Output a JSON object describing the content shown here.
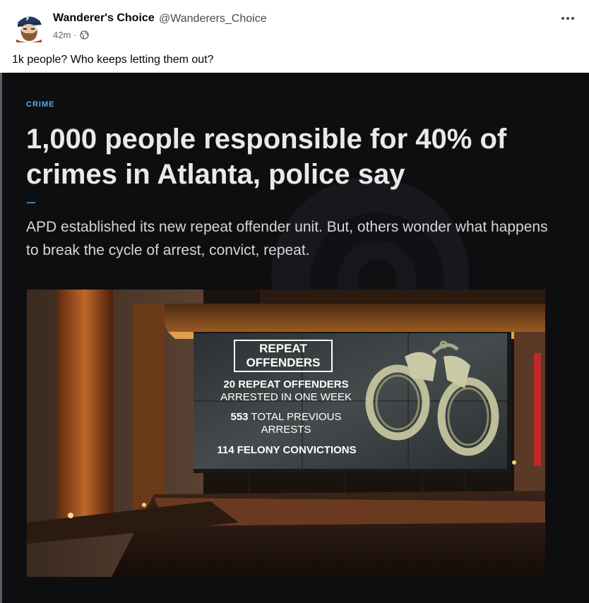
{
  "post": {
    "author_name": "Wanderer's Choice",
    "author_handle": "@Wanderers_Choice",
    "timestamp": "42m",
    "separator": "·",
    "privacy_icon": "globe-icon",
    "more_icon": "more-options-icon",
    "text": "1k people? Who keeps letting them out?"
  },
  "article": {
    "section": "CRIME",
    "headline": "1,000 people responsible for 40% of crimes in Atlanta, police say",
    "subhead": "APD established its new repeat offender unit. But, others wonder what happens to break the cycle of arrest, convict, repeat."
  },
  "screen": {
    "box_title_1": "REPEAT",
    "box_title_2": "OFFENDERS",
    "stat1_bold": "20 REPEAT OFFENDERS",
    "stat1_rest": "ARRESTED IN ONE WEEK",
    "stat2_bold": "553",
    "stat2_rest": "TOTAL PREVIOUS",
    "stat2_rest2": "ARRESTS",
    "stat3_bold": "114 FELONY CONVICTIONS"
  },
  "colors": {
    "accent": "#5aa9e6",
    "handcuff": "#bdbd9a"
  }
}
